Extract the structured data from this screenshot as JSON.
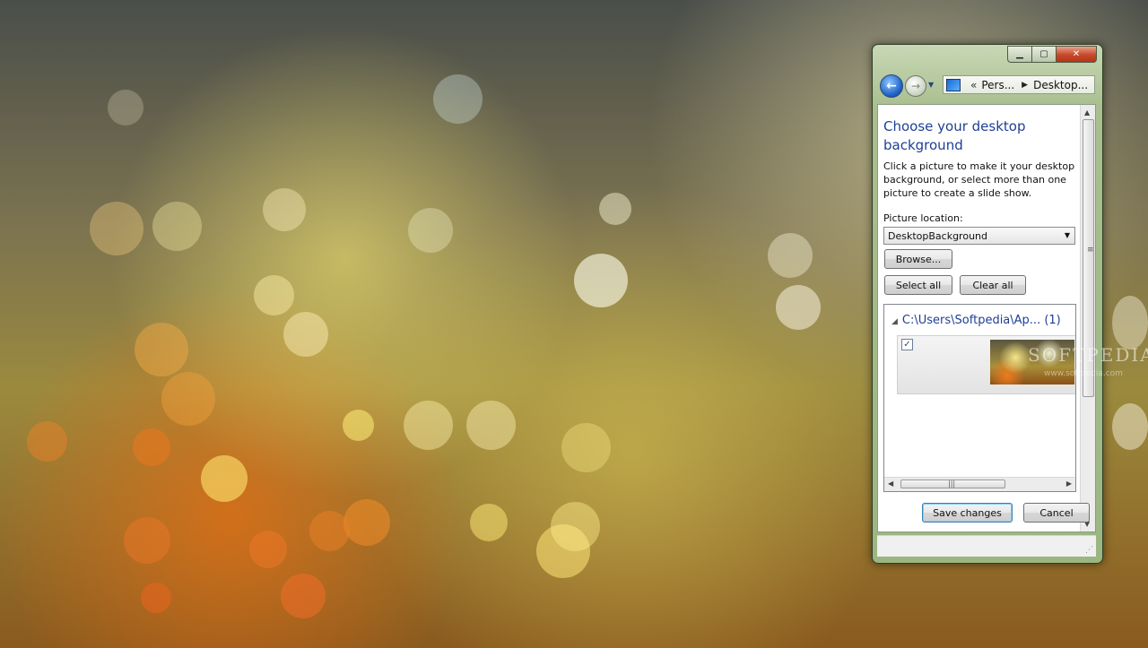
{
  "window": {
    "address": {
      "overflow": "«",
      "crumb1": "Pers...",
      "crumb2": "Desktop..."
    },
    "icons": {
      "back": "back-arrow-icon",
      "forward": "forward-arrow-icon",
      "minimize": "minimize-icon",
      "maximize": "maximize-icon",
      "close": "close-icon"
    }
  },
  "main": {
    "title": "Choose your desktop background",
    "description": "Click a picture to make it your desktop background, or select more than one picture to create a slide show.",
    "picture_location_label": "Picture location:",
    "picture_location_value": "DesktopBackground",
    "browse_label": "Browse...",
    "select_all_label": "Select all",
    "clear_all_label": "Clear all",
    "group_header": "C:\\Users\\Softpedia\\Ap... (1)",
    "checkbox_mark": "✓"
  },
  "footer": {
    "save_label": "Save changes",
    "cancel_label": "Cancel"
  },
  "watermark": {
    "text": "SOFTPEDIA",
    "sub": "www.softpedia.com"
  },
  "colors": {
    "title_blue": "#1e3f94",
    "frame_green": "#a9bf8f",
    "close_red": "#c6482b"
  }
}
